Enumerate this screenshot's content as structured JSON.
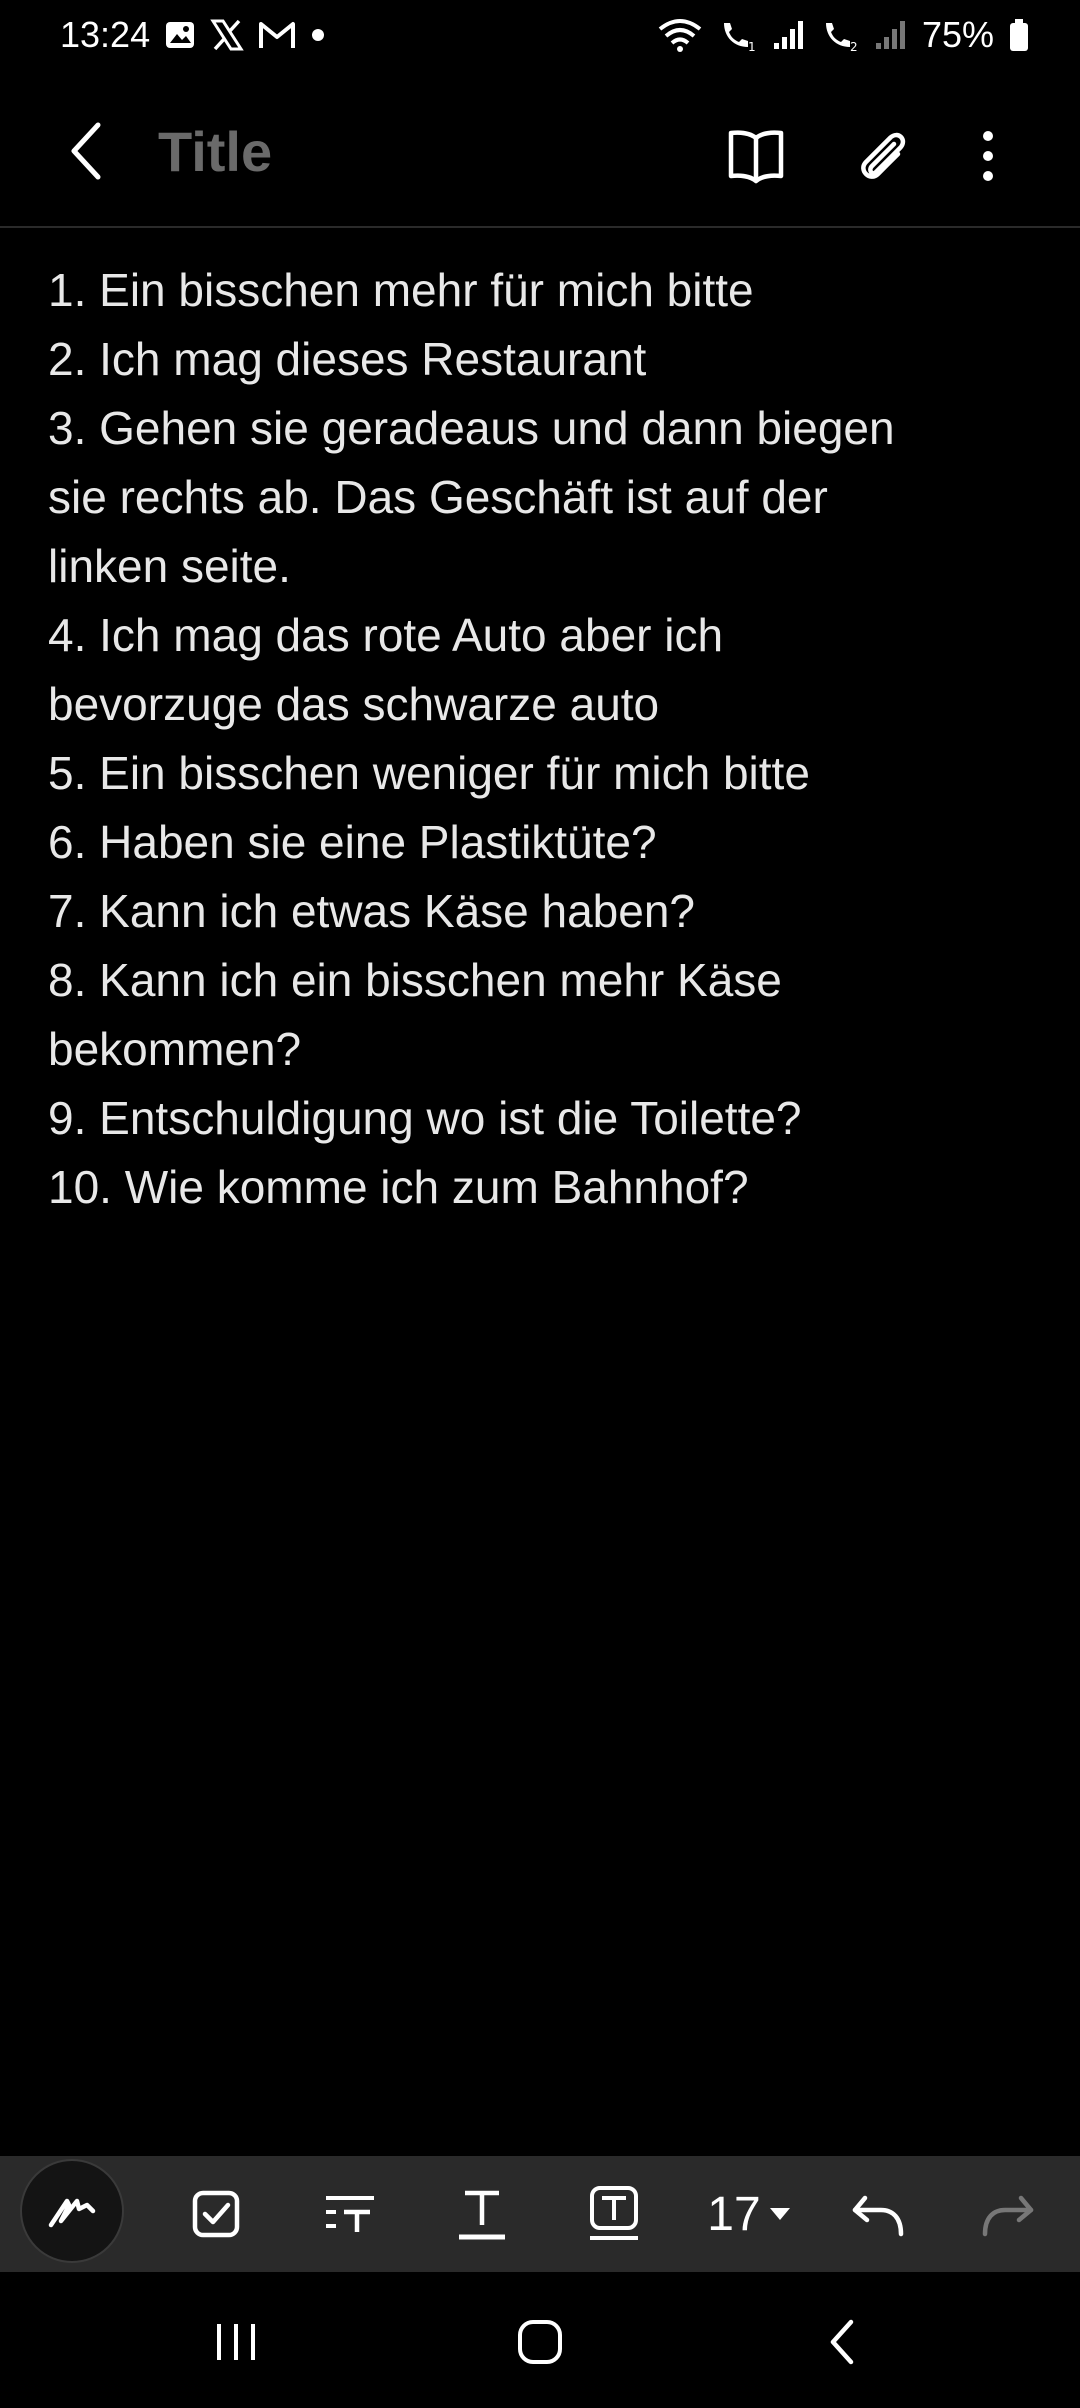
{
  "status_bar": {
    "time": "13:24",
    "notification_icons": [
      "gallery-icon",
      "x-icon",
      "gmail-icon",
      "dot-icon"
    ],
    "battery_percent": "75%"
  },
  "app_bar": {
    "title_placeholder": "Title",
    "title_value": ""
  },
  "note": {
    "lines": [
      "1. Ein bisschen mehr für mich bitte",
      "2. Ich mag dieses Restaurant",
      "3. Gehen sie geradeaus und dann biegen",
      "sie rechts ab. Das Geschäft ist auf der",
      "linken seite.",
      "4. Ich mag das rote Auto aber ich",
      "bevorzuge das schwarze auto",
      "5. Ein bisschen weniger für mich bitte",
      "6. Haben sie eine Plastiktüte?",
      "7. Kann ich etwas Käse haben?",
      "8. Kann ich ein bisschen mehr Käse",
      "bekommen?",
      "9. Entschuldigung wo ist die Toilette?",
      "10. Wie komme ich zum Bahnhof?"
    ]
  },
  "toolbar": {
    "font_size": "17"
  },
  "colors": {
    "background": "#000000",
    "toolbar": "#2a2a2a",
    "title_placeholder": "#6a6a6a",
    "text": "#e8e8e8"
  }
}
